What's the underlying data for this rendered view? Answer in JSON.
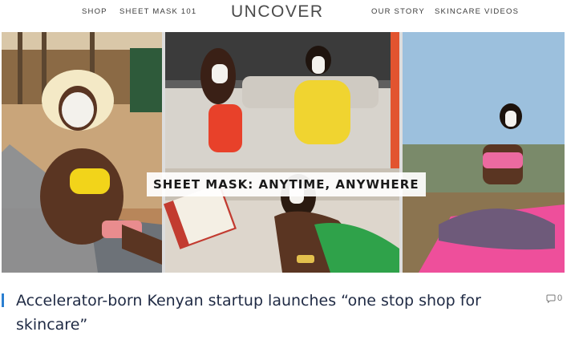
{
  "header": {
    "nav_left": [
      "SHOP",
      "SHEET MASK 101"
    ],
    "logo": "UNCOVER",
    "nav_right": [
      "OUR STORY",
      "SKINCARE VIDEOS"
    ]
  },
  "hero": {
    "caption": "SHEET MASK: ANYTIME, ANYWHERE"
  },
  "article": {
    "title": "Accelerator-born Kenyan startup launches “one stop shop for skincare”",
    "comment_count": "0",
    "accent_color": "#2b7fd1"
  },
  "icons": [
    "comment-icon"
  ]
}
